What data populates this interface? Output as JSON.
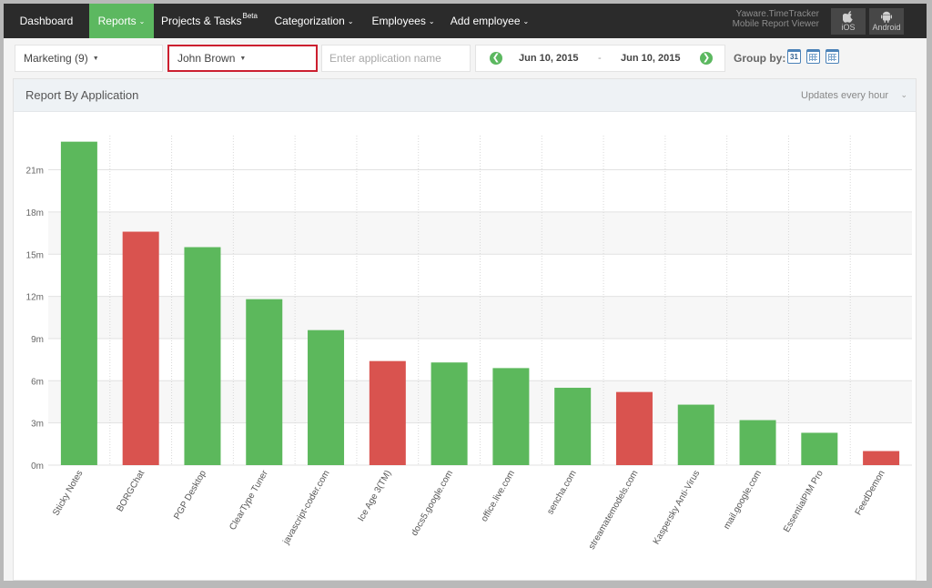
{
  "nav": {
    "items": [
      {
        "label": "Dashboard",
        "chevron": false,
        "sup": "",
        "active": false
      },
      {
        "label": "Reports",
        "chevron": true,
        "sup": "",
        "active": true
      },
      {
        "label": "Projects & Tasks",
        "chevron": false,
        "sup": "Beta",
        "active": false
      },
      {
        "label": "Categorization",
        "chevron": true,
        "sup": "",
        "active": false
      },
      {
        "label": "Employees",
        "chevron": true,
        "sup": "",
        "active": false
      },
      {
        "label": "Add employee",
        "chevron": true,
        "sup": "",
        "active": false
      }
    ],
    "brand_line1": "Yaware.TimeTracker",
    "brand_line2": "Mobile Report Viewer",
    "ios_label": "iOS",
    "android_label": "Android",
    "ios_icon": "apple-icon",
    "android_icon": "android-icon"
  },
  "toolbar": {
    "department": "Marketing (9)",
    "user": "John Brown",
    "app_placeholder": "Enter application name",
    "app_value": "",
    "date_from": "Jun 10, 2015",
    "date_sep": "-",
    "date_to": "Jun 10, 2015",
    "group_by_label": "Group by:",
    "group_by_day_number": "31"
  },
  "panel": {
    "title": "Report By Application",
    "update_text": "Updates every hour"
  },
  "colors": {
    "productive": "#5cb85c",
    "unproductive": "#d9534f",
    "nav_active": "#5cb860",
    "highlight_border": "#cc1f2f"
  },
  "chart_data": {
    "type": "bar",
    "categories": [
      "Sticky Notes",
      "BORGChat",
      "PGP Desktop",
      "ClearType Tuner",
      "javascript-coder.com",
      "Ice Age 3(TM)",
      "docs5.google.com",
      "office.live.com",
      "sencha.com",
      "streamatemodels.com",
      "Kaspersky Anti-Virus",
      "mail.google.com",
      "EssentialPIM Pro",
      "FeedDemon"
    ],
    "values": [
      23,
      16.6,
      15.5,
      11.8,
      9.6,
      7.4,
      7.3,
      6.9,
      5.5,
      5.2,
      4.3,
      3.2,
      2.3,
      1.0
    ],
    "productive": [
      true,
      false,
      true,
      true,
      true,
      false,
      true,
      true,
      true,
      false,
      true,
      true,
      true,
      false
    ],
    "yticks": [
      "0m",
      "3m",
      "6m",
      "9m",
      "12m",
      "15m",
      "18m",
      "21m"
    ],
    "ytick_values": [
      0,
      3,
      6,
      9,
      12,
      15,
      18,
      21
    ],
    "ylim": [
      0,
      23
    ],
    "title": "",
    "xlabel": "",
    "ylabel": "",
    "grid": true
  }
}
